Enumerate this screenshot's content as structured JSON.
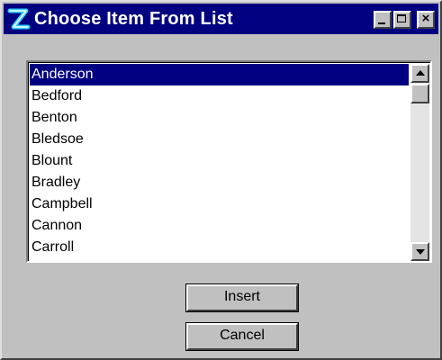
{
  "window": {
    "title": "Choose Item From List",
    "icon": "app-logo-icon",
    "controls": [
      "minimize-icon",
      "maximize-icon",
      "close-icon"
    ]
  },
  "list": {
    "items": [
      "Anderson",
      "Bedford",
      "Benton",
      "Bledsoe",
      "Blount",
      "Bradley",
      "Campbell",
      "Cannon",
      "Carroll"
    ],
    "selected": "Anderson"
  },
  "buttons": {
    "insert": "Insert",
    "cancel": "Cancel"
  },
  "colors": {
    "titlebar": "#000080",
    "selection": "#000080",
    "face": "#c0c0c0"
  }
}
